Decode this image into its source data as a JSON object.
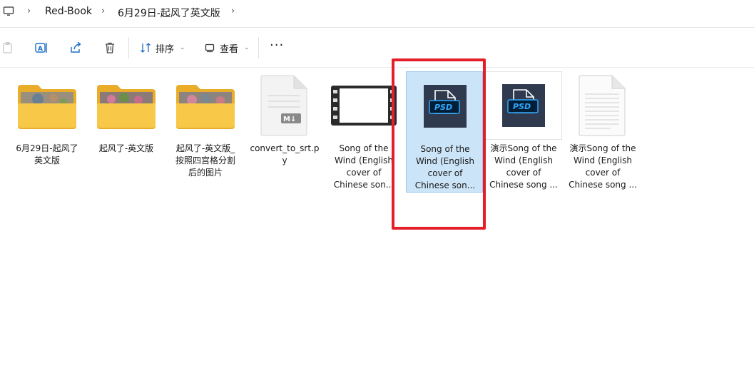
{
  "breadcrumb": {
    "icon": "monitor-icon",
    "items": [
      "Red-Book",
      "6月29日-起风了英文版"
    ]
  },
  "toolbar": {
    "sort_label": "排序",
    "view_label": "查看",
    "more_label": "···"
  },
  "files": [
    {
      "label": "6月29日-起风了\n英文版",
      "type": "folder"
    },
    {
      "label": "起风了-英文版",
      "type": "folder"
    },
    {
      "label": "起风了-英文版_\n按照四宫格分割\n后的图片",
      "type": "folder"
    },
    {
      "label": "convert_to_srt.p\ny",
      "type": "markdown",
      "badge": "M↓"
    },
    {
      "label": "Song of the\nWind (English\ncover of\nChinese son...",
      "type": "video"
    },
    {
      "label": "Song of the\nWind (English\ncover of\nChinese son...",
      "type": "psd",
      "badge": "PSD",
      "selected": true
    },
    {
      "label": "演示Song of the\nWind (English\ncover of\nChinese song ...",
      "type": "psd",
      "badge": "PSD"
    },
    {
      "label": "演示Song of the\nWind (English\ncover of\nChinese song ...",
      "type": "document"
    }
  ],
  "colors": {
    "selection": "#cce4f7",
    "highlight_frame": "#e3202a",
    "folder": "#f7c843",
    "psd_bg": "#2f3a4f",
    "psd_badge": "#001e36",
    "psd_text": "#31a8ff"
  }
}
